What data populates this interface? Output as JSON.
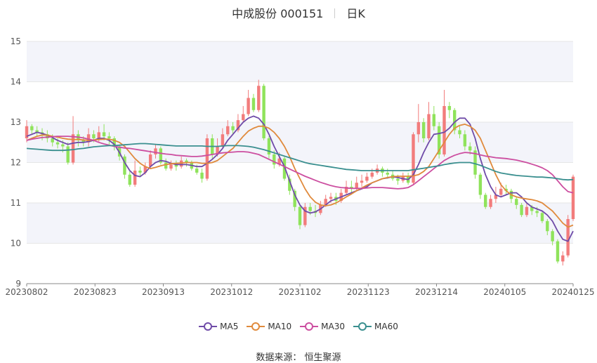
{
  "header": {
    "title": "中成股份 000151",
    "period": "日K"
  },
  "footer": {
    "source": "数据来源： 恒生聚源"
  },
  "colors": {
    "up": "#f27c7c",
    "down": "#8fe35b",
    "MA5": "#6f4ba8",
    "MA10": "#e08a3c",
    "MA30": "#cc4ea0",
    "MA60": "#3a8f8f"
  },
  "legend": [
    "MA5",
    "MA10",
    "MA30",
    "MA60"
  ],
  "chart_data": {
    "type": "candlestick",
    "ylim": [
      9,
      15
    ],
    "yticks": [
      9,
      10,
      11,
      12,
      13,
      14,
      15
    ],
    "xticks": [
      "20230802",
      "20230823",
      "20230913",
      "20231012",
      "20231102",
      "20231123",
      "20231214",
      "20240105",
      "20240125"
    ],
    "candles": [
      [
        12.6,
        12.9,
        12.5,
        13.05
      ],
      [
        12.9,
        12.8,
        12.7,
        12.95
      ],
      [
        12.8,
        12.75,
        12.65,
        12.9
      ],
      [
        12.75,
        12.7,
        12.55,
        12.85
      ],
      [
        12.7,
        12.6,
        12.5,
        12.8
      ],
      [
        12.6,
        12.5,
        12.4,
        12.7
      ],
      [
        12.5,
        12.45,
        12.35,
        12.6
      ],
      [
        12.45,
        12.4,
        12.25,
        12.55
      ],
      [
        12.4,
        12.0,
        11.95,
        12.5
      ],
      [
        12.0,
        12.7,
        11.95,
        13.15
      ],
      [
        12.7,
        12.55,
        12.4,
        12.8
      ],
      [
        12.55,
        12.5,
        12.4,
        12.65
      ],
      [
        12.5,
        12.7,
        12.4,
        12.85
      ],
      [
        12.7,
        12.6,
        12.5,
        12.8
      ],
      [
        12.6,
        12.75,
        12.5,
        12.9
      ],
      [
        12.75,
        12.65,
        12.55,
        12.95
      ],
      [
        12.65,
        12.6,
        12.45,
        12.75
      ],
      [
        12.6,
        12.4,
        12.3,
        12.65
      ],
      [
        12.4,
        12.15,
        12.05,
        12.45
      ],
      [
        12.15,
        11.7,
        11.6,
        12.2
      ],
      [
        11.7,
        11.45,
        11.4,
        11.8
      ],
      [
        11.45,
        11.8,
        11.4,
        12.05
      ],
      [
        11.8,
        11.75,
        11.65,
        11.9
      ],
      [
        11.75,
        11.9,
        11.7,
        12.0
      ],
      [
        11.9,
        12.2,
        11.85,
        12.3
      ],
      [
        12.2,
        12.35,
        12.1,
        12.45
      ],
      [
        12.35,
        12.0,
        11.95,
        12.4
      ],
      [
        12.0,
        11.85,
        11.8,
        12.1
      ],
      [
        11.85,
        11.95,
        11.8,
        12.05
      ],
      [
        11.95,
        11.9,
        11.8,
        12.05
      ],
      [
        11.9,
        12.05,
        11.85,
        12.15
      ],
      [
        12.05,
        12.0,
        11.9,
        12.1
      ],
      [
        12.0,
        11.85,
        11.8,
        12.05
      ],
      [
        11.85,
        11.75,
        11.7,
        11.95
      ],
      [
        11.75,
        11.6,
        11.5,
        11.85
      ],
      [
        11.6,
        12.6,
        11.55,
        12.7
      ],
      [
        12.6,
        12.2,
        12.1,
        12.7
      ],
      [
        12.2,
        12.4,
        12.15,
        12.6
      ],
      [
        12.4,
        12.7,
        12.35,
        12.85
      ],
      [
        12.7,
        12.9,
        12.65,
        13.05
      ],
      [
        12.9,
        12.8,
        12.7,
        13.0
      ],
      [
        12.8,
        13.05,
        12.75,
        13.2
      ],
      [
        13.05,
        13.2,
        13.0,
        13.4
      ],
      [
        13.2,
        13.6,
        13.15,
        13.8
      ],
      [
        13.6,
        13.3,
        13.25,
        13.7
      ],
      [
        13.3,
        13.9,
        13.25,
        14.05
      ],
      [
        13.9,
        12.6,
        12.55,
        13.95
      ],
      [
        12.6,
        12.2,
        12.1,
        12.65
      ],
      [
        12.2,
        11.95,
        11.85,
        12.3
      ],
      [
        11.95,
        12.1,
        11.9,
        12.25
      ],
      [
        12.1,
        11.6,
        11.55,
        12.15
      ],
      [
        11.6,
        11.3,
        11.2,
        11.7
      ],
      [
        11.3,
        10.9,
        10.8,
        11.35
      ],
      [
        10.9,
        10.45,
        10.35,
        10.95
      ],
      [
        10.45,
        10.9,
        10.4,
        11.0
      ],
      [
        10.9,
        10.8,
        10.7,
        11.0
      ],
      [
        10.8,
        10.75,
        10.65,
        10.95
      ],
      [
        10.75,
        10.95,
        10.7,
        11.05
      ],
      [
        10.95,
        11.1,
        10.9,
        11.2
      ],
      [
        11.1,
        11.15,
        11.0,
        11.25
      ],
      [
        11.15,
        11.05,
        10.95,
        11.25
      ],
      [
        11.05,
        11.25,
        11.0,
        11.35
      ],
      [
        11.25,
        11.4,
        11.2,
        11.55
      ],
      [
        11.4,
        11.35,
        11.25,
        11.55
      ],
      [
        11.35,
        11.5,
        11.3,
        11.65
      ],
      [
        11.5,
        11.55,
        11.4,
        11.7
      ],
      [
        11.55,
        11.65,
        11.5,
        11.75
      ],
      [
        11.65,
        11.75,
        11.6,
        11.85
      ],
      [
        11.75,
        11.85,
        11.7,
        11.95
      ],
      [
        11.85,
        11.75,
        11.65,
        11.9
      ],
      [
        11.75,
        11.7,
        11.6,
        11.85
      ],
      [
        11.7,
        11.6,
        11.55,
        11.8
      ],
      [
        11.6,
        11.55,
        11.45,
        11.7
      ],
      [
        11.55,
        11.65,
        11.5,
        11.75
      ],
      [
        11.65,
        11.5,
        11.45,
        11.75
      ],
      [
        11.5,
        12.7,
        11.45,
        12.75
      ],
      [
        12.7,
        13.0,
        12.5,
        13.45
      ],
      [
        13.0,
        12.6,
        12.5,
        13.1
      ],
      [
        12.6,
        13.2,
        12.55,
        13.5
      ],
      [
        13.2,
        12.9,
        12.8,
        13.4
      ],
      [
        12.9,
        12.2,
        12.1,
        13.0
      ],
      [
        12.2,
        13.4,
        12.15,
        13.8
      ],
      [
        13.4,
        13.3,
        13.1,
        13.5
      ],
      [
        13.3,
        12.8,
        12.7,
        13.35
      ],
      [
        12.8,
        12.7,
        12.6,
        12.9
      ],
      [
        12.7,
        12.4,
        12.3,
        12.8
      ],
      [
        12.4,
        12.3,
        12.2,
        12.5
      ],
      [
        12.3,
        11.7,
        11.6,
        12.4
      ],
      [
        11.7,
        11.2,
        11.1,
        11.75
      ],
      [
        11.2,
        10.9,
        10.85,
        11.25
      ],
      [
        10.9,
        11.1,
        10.85,
        11.2
      ],
      [
        11.1,
        11.2,
        11.0,
        11.4
      ],
      [
        11.2,
        11.35,
        11.15,
        11.5
      ],
      [
        11.35,
        11.3,
        11.2,
        11.45
      ],
      [
        11.3,
        11.1,
        11.0,
        11.35
      ],
      [
        11.1,
        10.95,
        10.85,
        11.15
      ],
      [
        10.95,
        10.7,
        10.65,
        11.0
      ],
      [
        10.7,
        10.9,
        10.65,
        11.0
      ],
      [
        10.9,
        10.8,
        10.7,
        10.95
      ],
      [
        10.8,
        10.75,
        10.65,
        10.9
      ],
      [
        10.75,
        10.55,
        10.5,
        10.8
      ],
      [
        10.55,
        10.3,
        10.2,
        10.6
      ],
      [
        10.3,
        10.05,
        9.95,
        10.35
      ],
      [
        10.05,
        9.55,
        9.5,
        10.1
      ],
      [
        9.55,
        9.7,
        9.45,
        9.8
      ],
      [
        9.7,
        10.6,
        9.65,
        10.7
      ],
      [
        10.6,
        11.65,
        10.55,
        11.7
      ]
    ],
    "series": [
      {
        "name": "MA5",
        "values": [
          12.65,
          12.7,
          12.75,
          12.72,
          12.68,
          12.62,
          12.55,
          12.5,
          12.45,
          12.48,
          12.5,
          12.5,
          12.52,
          12.55,
          12.6,
          12.6,
          12.55,
          12.45,
          12.25,
          12.0,
          11.8,
          11.68,
          11.65,
          11.75,
          11.9,
          12.0,
          12.05,
          12.03,
          11.98,
          11.95,
          11.95,
          11.95,
          11.93,
          11.9,
          11.9,
          11.98,
          12.08,
          12.2,
          12.35,
          12.55,
          12.7,
          12.85,
          13.0,
          13.1,
          13.15,
          13.1,
          12.95,
          12.7,
          12.4,
          12.15,
          11.9,
          11.55,
          11.2,
          10.95,
          10.8,
          10.75,
          10.78,
          10.85,
          10.95,
          11.05,
          11.1,
          11.15,
          11.2,
          11.25,
          11.3,
          11.35,
          11.4,
          11.5,
          11.55,
          11.6,
          11.62,
          11.65,
          11.63,
          11.6,
          11.58,
          11.7,
          11.95,
          12.25,
          12.5,
          12.7,
          12.72,
          12.75,
          12.85,
          13.0,
          13.1,
          13.1,
          12.95,
          12.6,
          12.1,
          11.7,
          11.4,
          11.2,
          11.15,
          11.2,
          11.25,
          11.25,
          11.15,
          11.0,
          10.9,
          10.85,
          10.8,
          10.7,
          10.55,
          10.3,
          10.1,
          10.05,
          10.3
        ]
      },
      {
        "name": "MA10",
        "values": [
          12.55,
          12.6,
          12.65,
          12.68,
          12.68,
          12.65,
          12.63,
          12.6,
          12.58,
          12.57,
          12.57,
          12.56,
          12.55,
          12.56,
          12.57,
          12.58,
          12.58,
          12.55,
          12.5,
          12.4,
          12.25,
          12.1,
          11.98,
          11.9,
          11.85,
          11.88,
          11.92,
          11.95,
          11.97,
          11.98,
          11.99,
          12.0,
          12.0,
          12.0,
          11.98,
          11.98,
          12.0,
          12.05,
          12.15,
          12.25,
          12.35,
          12.5,
          12.65,
          12.78,
          12.85,
          12.9,
          12.9,
          12.85,
          12.75,
          12.6,
          12.4,
          12.15,
          11.85,
          11.6,
          11.35,
          11.15,
          11.02,
          10.95,
          10.93,
          10.95,
          11.0,
          11.07,
          11.15,
          11.22,
          11.3,
          11.37,
          11.44,
          11.5,
          11.55,
          11.6,
          11.63,
          11.65,
          11.66,
          11.66,
          11.66,
          11.67,
          11.7,
          11.78,
          11.9,
          12.1,
          12.3,
          12.5,
          12.7,
          12.85,
          12.92,
          12.95,
          12.9,
          12.8,
          12.6,
          12.3,
          12.0,
          11.7,
          11.45,
          11.3,
          11.2,
          11.15,
          11.12,
          11.1,
          11.08,
          11.05,
          11.0,
          10.9,
          10.8,
          10.65,
          10.5,
          10.4,
          10.45
        ]
      },
      {
        "name": "MA30",
        "values": [
          12.55,
          12.58,
          12.6,
          12.62,
          12.63,
          12.64,
          12.65,
          12.65,
          12.65,
          12.64,
          12.63,
          12.61,
          12.58,
          12.55,
          12.5,
          12.46,
          12.43,
          12.4,
          12.38,
          12.36,
          12.35,
          12.33,
          12.31,
          12.29,
          12.27,
          12.25,
          12.23,
          12.21,
          12.2,
          12.18,
          12.17,
          12.16,
          12.15,
          12.15,
          12.16,
          12.18,
          12.2,
          12.22,
          12.24,
          12.25,
          12.26,
          12.27,
          12.27,
          12.26,
          12.23,
          12.2,
          12.14,
          12.08,
          12.02,
          11.96,
          11.9,
          11.84,
          11.78,
          11.72,
          11.66,
          11.61,
          11.56,
          11.51,
          11.47,
          11.43,
          11.4,
          11.38,
          11.37,
          11.36,
          11.36,
          11.36,
          11.37,
          11.38,
          11.38,
          11.38,
          11.37,
          11.36,
          11.35,
          11.36,
          11.38,
          11.45,
          11.55,
          11.65,
          11.75,
          11.85,
          11.95,
          12.05,
          12.12,
          12.18,
          12.22,
          12.25,
          12.24,
          12.22,
          12.19,
          12.16,
          12.14,
          12.12,
          12.11,
          12.1,
          12.08,
          12.06,
          12.03,
          12.0,
          11.96,
          11.92,
          11.87,
          11.8,
          11.7,
          11.55,
          11.4,
          11.28,
          11.25
        ]
      },
      {
        "name": "MA60",
        "values": [
          12.35,
          12.34,
          12.33,
          12.32,
          12.31,
          12.3,
          12.3,
          12.3,
          12.31,
          12.32,
          12.34,
          12.35,
          12.37,
          12.39,
          12.4,
          12.41,
          12.42,
          12.42,
          12.43,
          12.44,
          12.45,
          12.46,
          12.47,
          12.47,
          12.46,
          12.45,
          12.44,
          12.43,
          12.42,
          12.41,
          12.41,
          12.41,
          12.41,
          12.41,
          12.41,
          12.4,
          12.4,
          12.4,
          12.41,
          12.42,
          12.42,
          12.42,
          12.41,
          12.4,
          12.38,
          12.35,
          12.32,
          12.28,
          12.24,
          12.2,
          12.16,
          12.12,
          12.08,
          12.04,
          12.0,
          11.97,
          11.95,
          11.93,
          11.91,
          11.89,
          11.87,
          11.85,
          11.83,
          11.82,
          11.81,
          11.8,
          11.8,
          11.8,
          11.8,
          11.8,
          11.8,
          11.8,
          11.8,
          11.8,
          11.8,
          11.82,
          11.84,
          11.86,
          11.88,
          11.9,
          11.92,
          11.95,
          11.97,
          11.99,
          12.0,
          12.0,
          12.0,
          11.97,
          11.93,
          11.88,
          11.83,
          11.78,
          11.74,
          11.72,
          11.7,
          11.68,
          11.67,
          11.66,
          11.65,
          11.64,
          11.64,
          11.63,
          11.62,
          11.6,
          11.58,
          11.57,
          11.58
        ]
      }
    ]
  }
}
